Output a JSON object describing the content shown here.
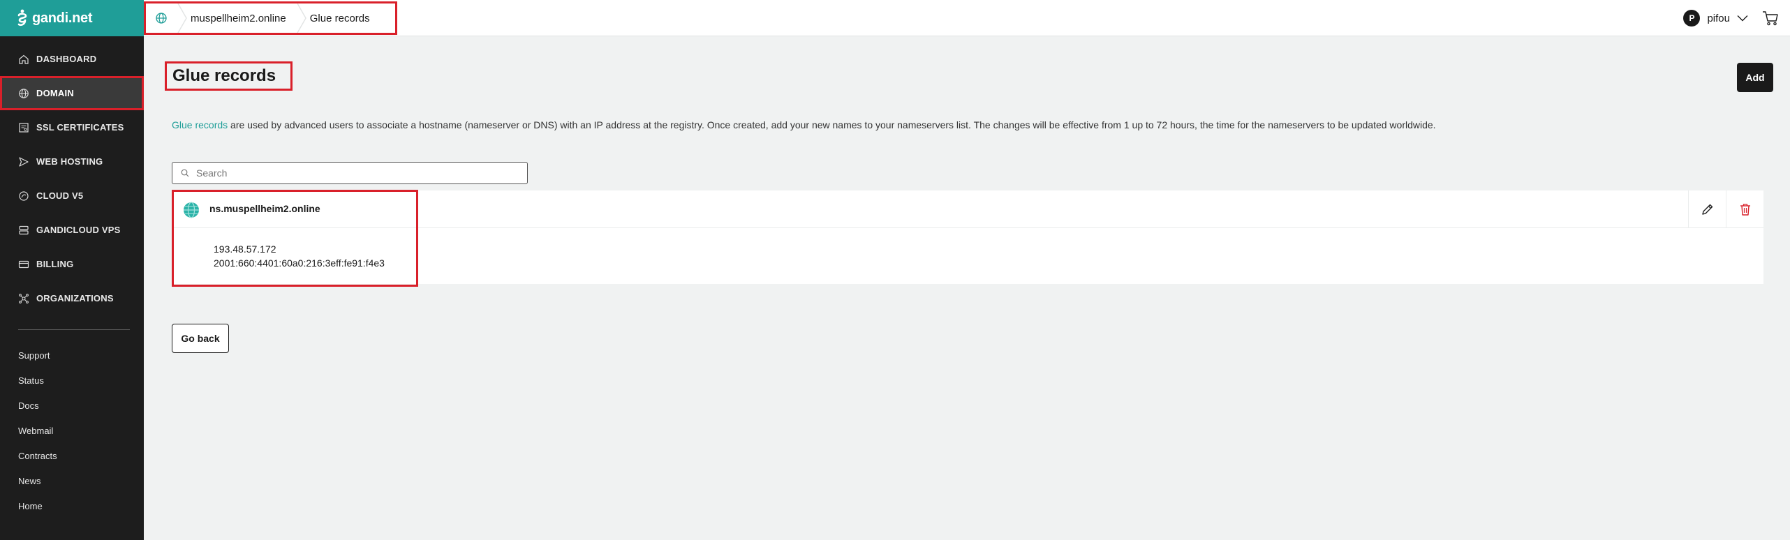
{
  "app": {
    "logo_text": "gandi.net"
  },
  "sidebar": {
    "items": [
      {
        "label": "DASHBOARD",
        "icon": "home-icon"
      },
      {
        "label": "DOMAIN",
        "icon": "globe-icon",
        "active": true
      },
      {
        "label": "SSL CERTIFICATES",
        "icon": "certificate-icon"
      },
      {
        "label": "WEB HOSTING",
        "icon": "send-icon"
      },
      {
        "label": "CLOUD V5",
        "icon": "cloud-icon"
      },
      {
        "label": "GANDICLOUD VPS",
        "icon": "server-icon"
      },
      {
        "label": "BILLING",
        "icon": "credit-card-icon"
      },
      {
        "label": "ORGANIZATIONS",
        "icon": "organization-icon"
      }
    ],
    "links": [
      "Support",
      "Status",
      "Docs",
      "Webmail",
      "Contracts",
      "News",
      "Home"
    ]
  },
  "breadcrumb": {
    "domain": "muspellheim2.online",
    "current": "Glue records"
  },
  "user": {
    "initial": "P",
    "name": "pifou"
  },
  "page": {
    "title": "Glue records",
    "add_label": "Add",
    "desc_link": "Glue records",
    "desc_text": " are used by advanced users to associate a hostname (nameserver or DNS) with an IP address at the registry. Once created, add your new names to your nameservers list. The changes will be effective from 1 up to 72 hours, the time for the nameservers to be updated worldwide.",
    "search_placeholder": "Search",
    "back_label": "Go back"
  },
  "glue_record": {
    "name": "ns.muspellheim2.online",
    "ipv4": "193.48.57.172",
    "ipv6": "2001:660:4401:60a0:216:3eff:fe91:f4e3"
  },
  "colors": {
    "brand": "#1f9e98",
    "highlight": "#d9202a",
    "danger": "#d9202a"
  }
}
